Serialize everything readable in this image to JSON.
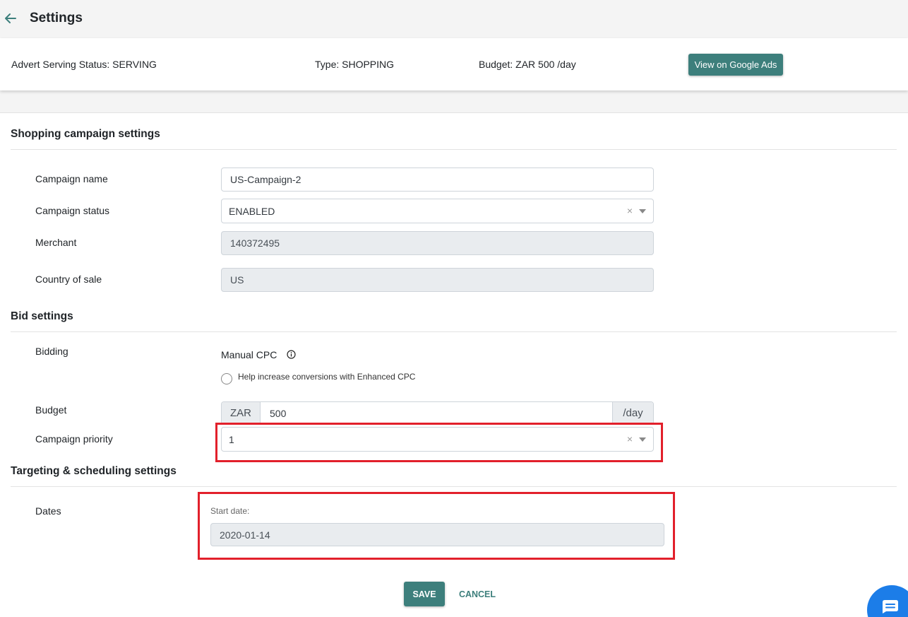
{
  "header": {
    "title": "Settings",
    "back_icon": "arrow-left-icon"
  },
  "status_bar": {
    "serving_status": "Advert Serving Status: SERVING",
    "type": "Type: SHOPPING",
    "budget": "Budget: ZAR 500 /day",
    "google_ads_button": "View on Google Ads"
  },
  "sections": {
    "shopping": {
      "title": "Shopping campaign settings",
      "campaign_name_label": "Campaign name",
      "campaign_name_value": "US-Campaign-2",
      "campaign_status_label": "Campaign status",
      "campaign_status_value": "ENABLED",
      "merchant_label": "Merchant",
      "merchant_value": "140372495",
      "country_label": "Country of sale",
      "country_value": "US"
    },
    "bid": {
      "title": "Bid settings",
      "bidding_label": "Bidding",
      "bidding_value": "Manual CPC",
      "enhanced_cpc_label": "Help increase conversions with Enhanced CPC",
      "enhanced_cpc_checked": false,
      "budget_label": "Budget",
      "budget_currency": "ZAR",
      "budget_value": "500",
      "budget_unit": "/day",
      "priority_label": "Campaign priority",
      "priority_value": "1"
    },
    "targeting": {
      "title": "Targeting & scheduling settings",
      "dates_label": "Dates",
      "start_date_label": "Start date:",
      "start_date_value": "2020-01-14"
    }
  },
  "actions": {
    "save": "SAVE",
    "cancel": "CANCEL"
  },
  "colors": {
    "primary": "#3d7f7c",
    "highlight": "#e2202b",
    "chat": "#1c7de8"
  }
}
